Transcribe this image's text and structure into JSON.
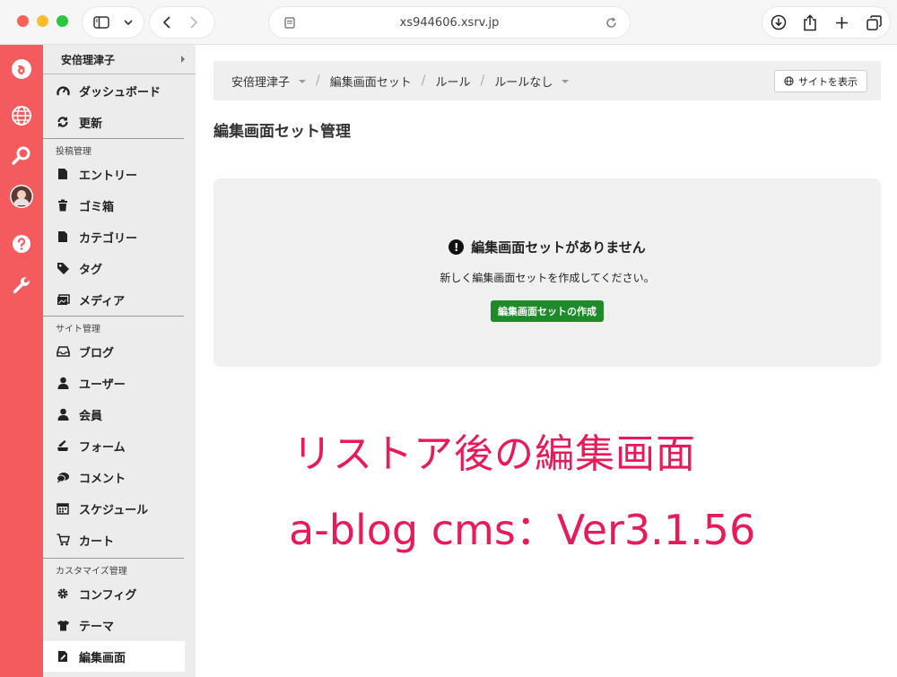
{
  "browser": {
    "url": "xs944606.xsrv.jp"
  },
  "sidebar": {
    "site_name": "安倍理津子",
    "top_items": [
      {
        "label": "ダッシュボード",
        "icon": "dashboard-icon"
      },
      {
        "label": "更新",
        "icon": "refresh-icon"
      }
    ],
    "sections": [
      {
        "label": "投稿管理",
        "items": [
          {
            "label": "エントリー",
            "icon": "document-icon"
          },
          {
            "label": "ゴミ箱",
            "icon": "trash-icon"
          },
          {
            "label": "カテゴリー",
            "icon": "folder-icon"
          },
          {
            "label": "タグ",
            "icon": "tag-icon"
          },
          {
            "label": "メディア",
            "icon": "media-icon"
          }
        ]
      },
      {
        "label": "サイト管理",
        "items": [
          {
            "label": "ブログ",
            "icon": "inbox-icon"
          },
          {
            "label": "ユーザー",
            "icon": "user-icon"
          },
          {
            "label": "会員",
            "icon": "member-icon"
          },
          {
            "label": "フォーム",
            "icon": "form-icon"
          },
          {
            "label": "コメント",
            "icon": "comment-icon"
          },
          {
            "label": "スケジュール",
            "icon": "calendar-icon"
          },
          {
            "label": "カート",
            "icon": "cart-icon"
          }
        ]
      },
      {
        "label": "カスタマイズ管理",
        "items": [
          {
            "label": "コンフィグ",
            "icon": "gear-icon"
          },
          {
            "label": "テーマ",
            "icon": "shirt-icon"
          },
          {
            "label": "編集画面",
            "icon": "edit-icon",
            "active": true
          }
        ]
      }
    ]
  },
  "breadcrumb": {
    "items": [
      "安倍理津子",
      "編集画面セット",
      "ルール",
      "ルールなし"
    ],
    "view_site_label": "サイトを表示"
  },
  "main": {
    "title": "編集画面セット管理",
    "empty_title": "編集画面セットがありません",
    "empty_message": "新しく編集画面セットを作成してください。",
    "create_button": "編集画面セットの作成"
  },
  "overlay": {
    "line1": "リストア後の編集画面",
    "line2": "a-blog cms：Ver3.1.56"
  },
  "colors": {
    "rail": "#f45b5e",
    "primary_button": "#1e8a2a",
    "overlay_text": "#e81a5a"
  }
}
